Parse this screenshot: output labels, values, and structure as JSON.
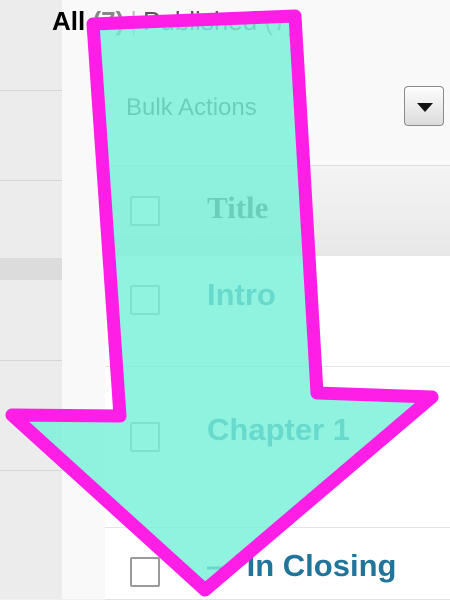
{
  "filters": {
    "all_label": "All",
    "all_count": "(7)",
    "separator": "|",
    "published_label": "Published",
    "published_count": "(7)"
  },
  "bulk_actions": {
    "label": "Bulk Actions"
  },
  "table": {
    "column_title": "Title",
    "rows": [
      {
        "title": "Intro"
      },
      {
        "title": "Chapter 1"
      },
      {
        "title": "— In Closing"
      }
    ]
  },
  "annotation": {
    "arrow_fill": "#78f0d8",
    "arrow_stroke": "#ff1ee6"
  }
}
